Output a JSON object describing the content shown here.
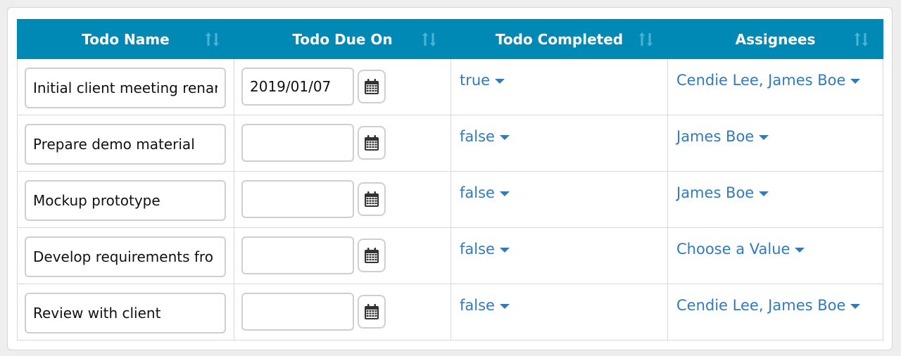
{
  "colors": {
    "header_bg": "#0089b5",
    "header_text": "#ffffff",
    "link": "#337ab7",
    "border": "#d7d7d7"
  },
  "header": {
    "columns": [
      {
        "label": "Todo Name",
        "sort_icon": "sort-icon"
      },
      {
        "label": "Todo Due On",
        "sort_icon": "sort-icon"
      },
      {
        "label": "Todo Completed",
        "sort_icon": "sort-icon"
      },
      {
        "label": "Assignees",
        "sort_icon": "sort-icon"
      }
    ]
  },
  "rows": [
    {
      "name": "Initial client meeting renar",
      "due": "2019/01/07",
      "completed": "true",
      "assignees": "Cendie Lee, James Boe"
    },
    {
      "name": "Prepare demo material",
      "due": "",
      "completed": "false",
      "assignees": "James Boe"
    },
    {
      "name": "Mockup prototype",
      "due": "",
      "completed": "false",
      "assignees": "James Boe"
    },
    {
      "name": "Develop requirements fro",
      "due": "",
      "completed": "false",
      "assignees": "Choose a Value"
    },
    {
      "name": "Review with client",
      "due": "",
      "completed": "false",
      "assignees": "Cendie Lee, James Boe"
    }
  ],
  "calendar_icon": "calendar-icon"
}
